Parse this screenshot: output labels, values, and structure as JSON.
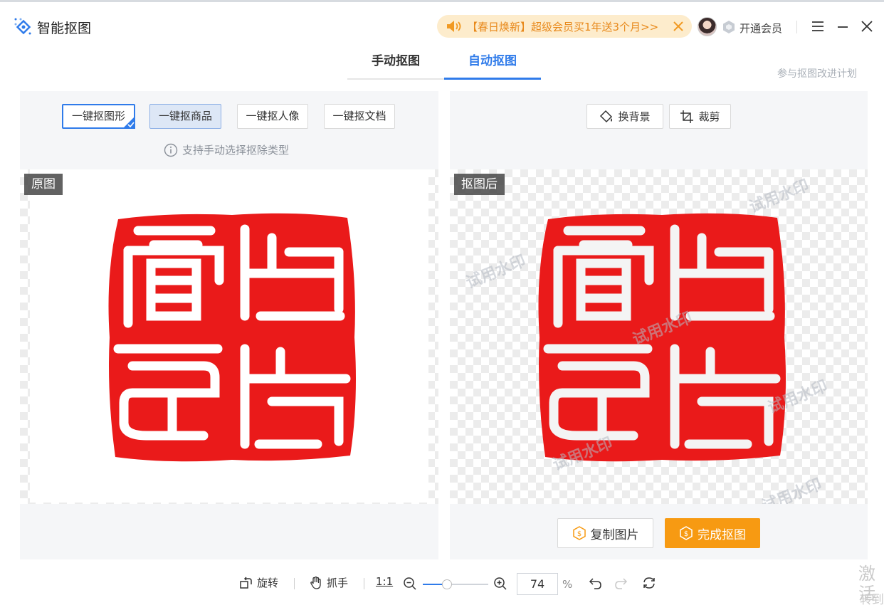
{
  "app": {
    "title": "智能抠图"
  },
  "promo": {
    "text": "【春日焕新】超级会员买1年送3个月>>"
  },
  "header": {
    "vip_label": "开通会员"
  },
  "tabs": [
    {
      "label": "手动抠图",
      "active": false
    },
    {
      "label": "自动抠图",
      "active": true
    }
  ],
  "join_link": "参与抠图改进计划",
  "left": {
    "modes": [
      {
        "label": "一键抠图形",
        "selected": true
      },
      {
        "label": "一键抠商品",
        "selected": false
      },
      {
        "label": "一键抠人像",
        "selected": false
      },
      {
        "label": "一键抠文档",
        "selected": false
      }
    ],
    "hint": "支持手动选择抠除类型",
    "canvas_label": "原图"
  },
  "right": {
    "tools": [
      {
        "label": "换背景",
        "icon": "paint-bucket-icon"
      },
      {
        "label": "裁剪",
        "icon": "crop-icon"
      }
    ],
    "canvas_label": "抠图后",
    "watermark": "试用水印",
    "copy_label": "复制图片",
    "done_label": "完成抠图"
  },
  "bottombar": {
    "rotate": "旋转",
    "hand": "抓手",
    "one_to_one": "1:1",
    "zoom": "74",
    "zoom_unit": "%"
  },
  "overlay": {
    "activate_1": "激活",
    "activate_2": "转到"
  },
  "colors": {
    "accent": "#2f7bea",
    "orange": "#f79a12",
    "seal_red": "#ea1a1a",
    "promo_bg": "#fdeccc"
  }
}
